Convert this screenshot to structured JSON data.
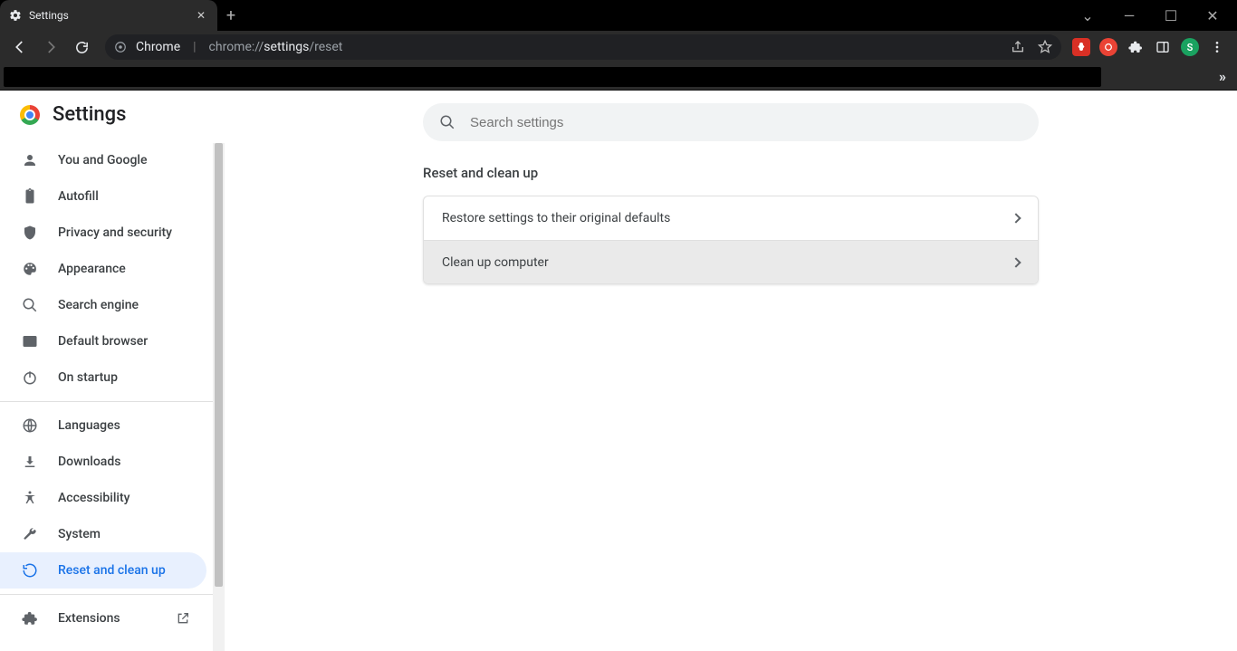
{
  "window": {
    "tab_title": "Settings",
    "dropdown_glyph": "⌄",
    "minimize_glyph": "—",
    "maximize_glyph": "☐",
    "close_glyph": "✕",
    "newtab_glyph": "+",
    "tab_close_glyph": "✕"
  },
  "toolbar": {
    "url_context": "Chrome",
    "url_prefix": "chrome://",
    "url_main": "settings",
    "url_suffix": "/reset",
    "avatar_initial": "S",
    "overflow_glyph": "»"
  },
  "brand": {
    "title": "Settings"
  },
  "search": {
    "placeholder": "Search settings"
  },
  "sidebar": {
    "items": [
      {
        "label": "You and Google"
      },
      {
        "label": "Autofill"
      },
      {
        "label": "Privacy and security"
      },
      {
        "label": "Appearance"
      },
      {
        "label": "Search engine"
      },
      {
        "label": "Default browser"
      },
      {
        "label": "On startup"
      }
    ],
    "items2": [
      {
        "label": "Languages"
      },
      {
        "label": "Downloads"
      },
      {
        "label": "Accessibility"
      },
      {
        "label": "System"
      },
      {
        "label": "Reset and clean up"
      }
    ],
    "extensions_label": "Extensions"
  },
  "main": {
    "section_title": "Reset and clean up",
    "rows": [
      {
        "label": "Restore settings to their original defaults"
      },
      {
        "label": "Clean up computer"
      }
    ]
  }
}
